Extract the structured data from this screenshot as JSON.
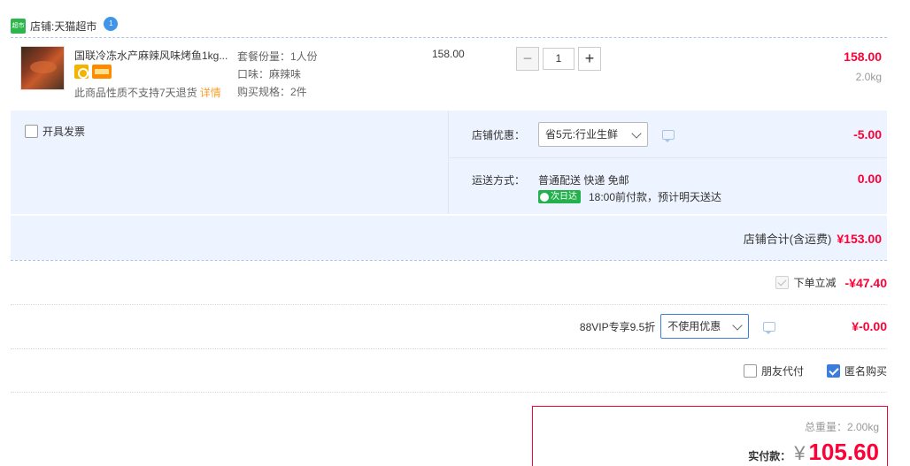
{
  "shop": {
    "icon_text": "超市",
    "name_prefix": "店铺: ",
    "name": "天猫超市",
    "chat_badge": "1"
  },
  "item": {
    "title": "国联冷冻水产麻辣风味烤鱼1kg...",
    "note": "此商品性质不支持7天退货",
    "detail_link": "详情",
    "attrs": [
      "套餐份量：1人份",
      "口味：麻辣味",
      "购买规格：2件"
    ],
    "unit_price": "158.00",
    "quantity": "1",
    "minus": "−",
    "plus": "+",
    "total": "158.00",
    "weight": "2.0kg"
  },
  "invoice": {
    "label": "开具发票"
  },
  "shop_discount": {
    "label": "店铺优惠：",
    "selected": "省5元:行业生鲜",
    "amount": "-5.00"
  },
  "shipping": {
    "label": "运送方式：",
    "method": "普通配送 快递 免邮",
    "badge": "次日达",
    "eta": "18:00前付款，预计明天送达",
    "amount": "0.00"
  },
  "shop_total": {
    "label": "店铺合计(含运费)",
    "value": "¥153.00"
  },
  "instant_discount": {
    "label": "下单立减",
    "value": "-¥47.40"
  },
  "vip": {
    "label": "88VIP专享9.5折",
    "selected": "不使用优惠",
    "value": "¥-0.00"
  },
  "options": {
    "friend_pay": "朋友代付",
    "anonymous": "匿名购买"
  },
  "summary": {
    "total_weight": "总重量：2.00kg",
    "pay_label": "实付款：",
    "currency": "¥",
    "pay_value": "105.60"
  },
  "colors": {
    "accent_red": "#ff0036",
    "panel_blue": "#eef4ff",
    "link_orange": "#f69f2e",
    "check_blue": "#3b7ddd"
  }
}
